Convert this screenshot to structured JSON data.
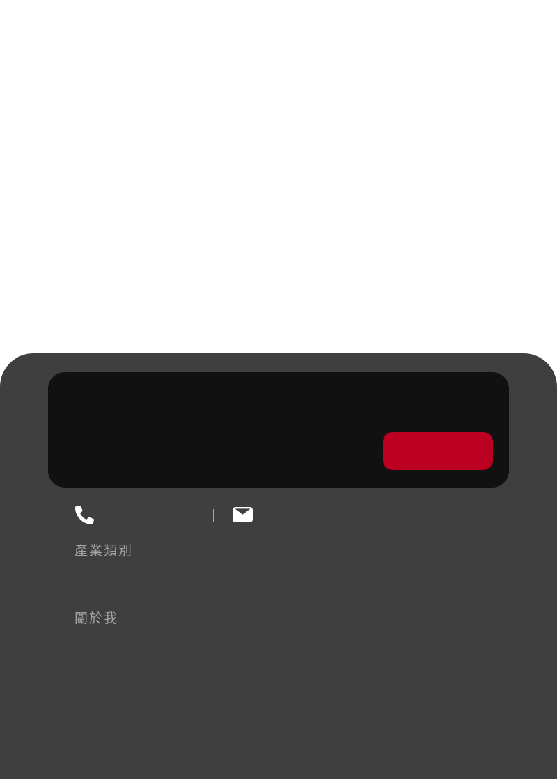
{
  "colors": {
    "page_background": "#ffffff",
    "panel_background": "#3f3f3f",
    "card_background": "#111111",
    "accent_button": "#bb0022",
    "label_text": "#a3a3a3",
    "icon": "#ffffff"
  },
  "profile_card": {
    "action_button_label": ""
  },
  "contact": {
    "phone_icon": "phone-icon",
    "phone_value": "",
    "mail_icon": "envelope-icon",
    "email_value": ""
  },
  "sections": {
    "industry_label": "產業類別",
    "industry_value": "",
    "about_label": "關於我",
    "about_value": ""
  }
}
